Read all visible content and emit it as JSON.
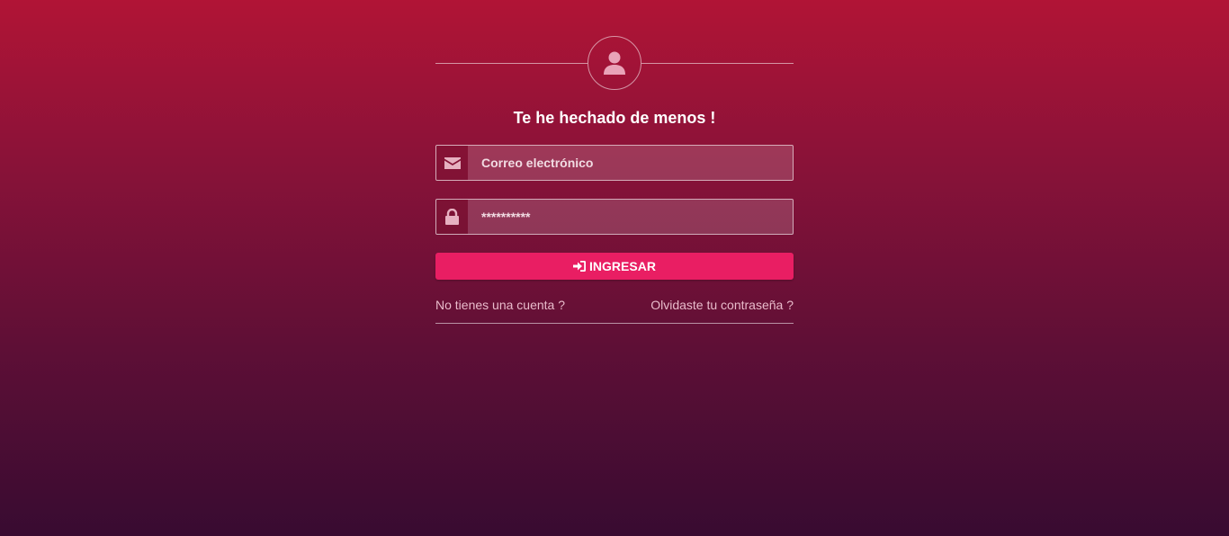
{
  "login": {
    "title": "Te he hechado de menos !",
    "email": {
      "placeholder": "Correo electrónico",
      "value": "",
      "icon": "envelope-icon"
    },
    "password": {
      "placeholder": "**********",
      "value": "",
      "icon": "lock-icon"
    },
    "submit": {
      "label": "INGRESAR",
      "icon": "sign-in-icon"
    },
    "links": {
      "register": "No tienes una cuenta ?",
      "forgot": "Olvidaste tu contraseña ?"
    },
    "avatar_icon": "user-icon"
  },
  "colors": {
    "accent": "#e91e63",
    "background_top": "#b11436",
    "background_bottom": "#380b31",
    "link": "#e9bccb"
  }
}
